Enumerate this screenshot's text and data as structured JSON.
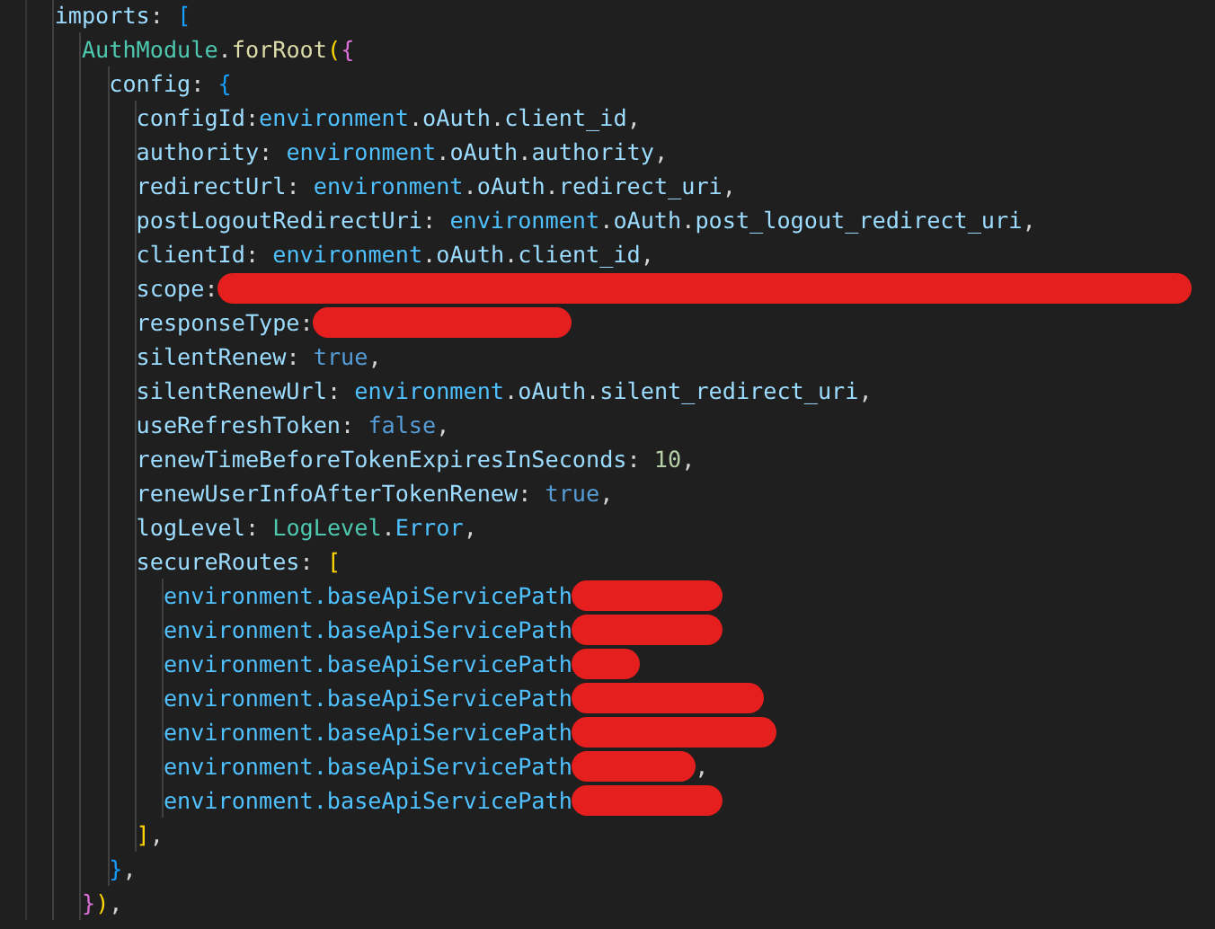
{
  "editor": {
    "lines": [
      {
        "tokens": [
          {
            "kind": "prop",
            "text": "imports"
          },
          {
            "kind": "punc",
            "text": ": "
          },
          {
            "kind": "br3",
            "text": "["
          }
        ],
        "children": [
          {
            "tokens": [
              {
                "kind": "class",
                "text": "AuthModule"
              },
              {
                "kind": "punc",
                "text": "."
              },
              {
                "kind": "func",
                "text": "forRoot"
              },
              {
                "kind": "br1",
                "text": "("
              },
              {
                "kind": "br2",
                "text": "{"
              }
            ],
            "children": [
              {
                "tokens": [
                  {
                    "kind": "prop",
                    "text": "config"
                  },
                  {
                    "kind": "punc",
                    "text": ": "
                  },
                  {
                    "kind": "br3",
                    "text": "{"
                  }
                ],
                "children": [
                  {
                    "tokens": [
                      {
                        "kind": "prop",
                        "text": "configId"
                      },
                      {
                        "kind": "punc",
                        "text": ":"
                      },
                      {
                        "kind": "var",
                        "text": "environment"
                      },
                      {
                        "kind": "punc",
                        "text": "."
                      },
                      {
                        "kind": "prop",
                        "text": "oAuth"
                      },
                      {
                        "kind": "punc",
                        "text": "."
                      },
                      {
                        "kind": "prop",
                        "text": "client_id"
                      },
                      {
                        "kind": "punc",
                        "text": ","
                      }
                    ]
                  },
                  {
                    "tokens": [
                      {
                        "kind": "prop",
                        "text": "authority"
                      },
                      {
                        "kind": "punc",
                        "text": ": "
                      },
                      {
                        "kind": "var",
                        "text": "environment"
                      },
                      {
                        "kind": "punc",
                        "text": "."
                      },
                      {
                        "kind": "prop",
                        "text": "oAuth"
                      },
                      {
                        "kind": "punc",
                        "text": "."
                      },
                      {
                        "kind": "prop",
                        "text": "authority"
                      },
                      {
                        "kind": "punc",
                        "text": ","
                      }
                    ]
                  },
                  {
                    "tokens": [
                      {
                        "kind": "prop",
                        "text": "redirectUrl"
                      },
                      {
                        "kind": "punc",
                        "text": ": "
                      },
                      {
                        "kind": "var",
                        "text": "environment"
                      },
                      {
                        "kind": "punc",
                        "text": "."
                      },
                      {
                        "kind": "prop",
                        "text": "oAuth"
                      },
                      {
                        "kind": "punc",
                        "text": "."
                      },
                      {
                        "kind": "prop",
                        "text": "redirect_uri"
                      },
                      {
                        "kind": "punc",
                        "text": ","
                      }
                    ]
                  },
                  {
                    "tokens": [
                      {
                        "kind": "prop",
                        "text": "postLogoutRedirectUri"
                      },
                      {
                        "kind": "punc",
                        "text": ": "
                      },
                      {
                        "kind": "var",
                        "text": "environment"
                      },
                      {
                        "kind": "punc",
                        "text": "."
                      },
                      {
                        "kind": "prop",
                        "text": "oAuth"
                      },
                      {
                        "kind": "punc",
                        "text": "."
                      },
                      {
                        "kind": "prop",
                        "text": "post_logout_redirect_uri"
                      },
                      {
                        "kind": "punc",
                        "text": ","
                      }
                    ]
                  },
                  {
                    "tokens": [
                      {
                        "kind": "prop",
                        "text": "clientId"
                      },
                      {
                        "kind": "punc",
                        "text": ": "
                      },
                      {
                        "kind": "var",
                        "text": "environment"
                      },
                      {
                        "kind": "punc",
                        "text": "."
                      },
                      {
                        "kind": "prop",
                        "text": "oAuth"
                      },
                      {
                        "kind": "punc",
                        "text": "."
                      },
                      {
                        "kind": "prop",
                        "text": "client_id"
                      },
                      {
                        "kind": "punc",
                        "text": ","
                      }
                    ]
                  },
                  {
                    "tokens": [
                      {
                        "kind": "prop",
                        "text": "scope"
                      },
                      {
                        "kind": "punc",
                        "text": ":"
                      },
                      {
                        "kind": "redacted"
                      }
                    ]
                  },
                  {
                    "tokens": [
                      {
                        "kind": "prop",
                        "text": "responseType"
                      },
                      {
                        "kind": "punc",
                        "text": ":"
                      },
                      {
                        "kind": "redacted"
                      }
                    ]
                  },
                  {
                    "tokens": [
                      {
                        "kind": "prop",
                        "text": "silentRenew"
                      },
                      {
                        "kind": "punc",
                        "text": ": "
                      },
                      {
                        "kind": "kw",
                        "text": "true"
                      },
                      {
                        "kind": "punc",
                        "text": ","
                      }
                    ]
                  },
                  {
                    "tokens": [
                      {
                        "kind": "prop",
                        "text": "silentRenewUrl"
                      },
                      {
                        "kind": "punc",
                        "text": ": "
                      },
                      {
                        "kind": "var",
                        "text": "environment"
                      },
                      {
                        "kind": "punc",
                        "text": "."
                      },
                      {
                        "kind": "prop",
                        "text": "oAuth"
                      },
                      {
                        "kind": "punc",
                        "text": "."
                      },
                      {
                        "kind": "prop",
                        "text": "silent_redirect_uri"
                      },
                      {
                        "kind": "punc",
                        "text": ","
                      }
                    ]
                  },
                  {
                    "tokens": [
                      {
                        "kind": "prop",
                        "text": "useRefreshToken"
                      },
                      {
                        "kind": "punc",
                        "text": ": "
                      },
                      {
                        "kind": "kw",
                        "text": "false"
                      },
                      {
                        "kind": "punc",
                        "text": ","
                      }
                    ]
                  },
                  {
                    "tokens": [
                      {
                        "kind": "prop",
                        "text": "renewTimeBeforeTokenExpiresInSeconds"
                      },
                      {
                        "kind": "punc",
                        "text": ": "
                      },
                      {
                        "kind": "num",
                        "text": "10"
                      },
                      {
                        "kind": "punc",
                        "text": ","
                      }
                    ]
                  },
                  {
                    "tokens": [
                      {
                        "kind": "prop",
                        "text": "renewUserInfoAfterTokenRenew"
                      },
                      {
                        "kind": "punc",
                        "text": ": "
                      },
                      {
                        "kind": "kw",
                        "text": "true"
                      },
                      {
                        "kind": "punc",
                        "text": ","
                      }
                    ]
                  },
                  {
                    "tokens": [
                      {
                        "kind": "prop",
                        "text": "logLevel"
                      },
                      {
                        "kind": "punc",
                        "text": ": "
                      },
                      {
                        "kind": "class",
                        "text": "LogLevel"
                      },
                      {
                        "kind": "punc",
                        "text": "."
                      },
                      {
                        "kind": "var",
                        "text": "Error"
                      },
                      {
                        "kind": "punc",
                        "text": ","
                      }
                    ]
                  },
                  {
                    "tokens": [
                      {
                        "kind": "prop",
                        "text": "secureRoutes"
                      },
                      {
                        "kind": "punc",
                        "text": ": "
                      },
                      {
                        "kind": "br1",
                        "text": "["
                      }
                    ],
                    "children": [
                      {
                        "tokens": [
                          {
                            "kind": "var",
                            "text": "environment.baseApiServicePath"
                          },
                          {
                            "kind": "redacted"
                          }
                        ]
                      },
                      {
                        "tokens": [
                          {
                            "kind": "var",
                            "text": "environment.baseApiServicePath"
                          },
                          {
                            "kind": "redacted"
                          }
                        ]
                      },
                      {
                        "tokens": [
                          {
                            "kind": "var",
                            "text": "environment.baseApiServicePath"
                          },
                          {
                            "kind": "redacted"
                          }
                        ]
                      },
                      {
                        "tokens": [
                          {
                            "kind": "var",
                            "text": "environment.baseApiServicePath"
                          },
                          {
                            "kind": "redacted"
                          }
                        ]
                      },
                      {
                        "tokens": [
                          {
                            "kind": "var",
                            "text": "environment.baseApiServicePath"
                          },
                          {
                            "kind": "redacted"
                          }
                        ]
                      },
                      {
                        "tokens": [
                          {
                            "kind": "var",
                            "text": "environment.baseApiServicePath"
                          },
                          {
                            "kind": "redacted"
                          },
                          {
                            "kind": "punc",
                            "text": ","
                          }
                        ]
                      },
                      {
                        "tokens": [
                          {
                            "kind": "var",
                            "text": "environment.baseApiServicePath"
                          },
                          {
                            "kind": "redacted"
                          }
                        ]
                      }
                    ]
                  },
                  {
                    "tokens": [
                      {
                        "kind": "br1",
                        "text": "]"
                      },
                      {
                        "kind": "punc",
                        "text": ","
                      }
                    ]
                  }
                ]
              },
              {
                "tokens": [
                  {
                    "kind": "br3",
                    "text": "}"
                  },
                  {
                    "kind": "punc",
                    "text": ","
                  }
                ]
              }
            ]
          },
          {
            "tokens": [
              {
                "kind": "br2",
                "text": "}"
              },
              {
                "kind": "br1",
                "text": ")"
              },
              {
                "kind": "punc",
                "text": ","
              }
            ]
          }
        ]
      }
    ]
  }
}
